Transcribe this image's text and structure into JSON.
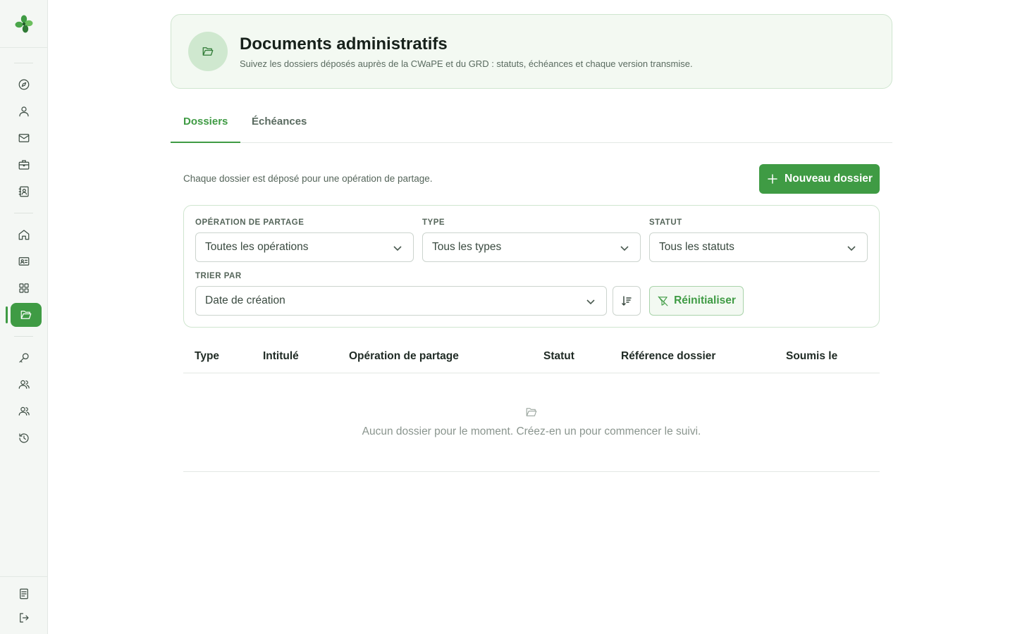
{
  "app": {
    "brand_color": "#3f9b44"
  },
  "sidebar": {
    "items": [
      {
        "icon": "compass-icon"
      },
      {
        "icon": "user-icon"
      },
      {
        "icon": "mail-icon"
      },
      {
        "icon": "briefcase-icon"
      },
      {
        "icon": "contact-book-icon"
      },
      {
        "icon": "home-icon"
      },
      {
        "icon": "id-card-icon"
      },
      {
        "icon": "grid-icon"
      },
      {
        "icon": "folder-open-icon",
        "active": true
      },
      {
        "icon": "search-key-icon"
      },
      {
        "icon": "users-icon"
      },
      {
        "icon": "users-alt-icon"
      },
      {
        "icon": "history-icon"
      },
      {
        "icon": "document-icon"
      },
      {
        "icon": "logout-icon"
      }
    ]
  },
  "header": {
    "title": "Documents administratifs",
    "subtitle": "Suivez les dossiers déposés auprès de la CWaPE et du GRD : statuts, échéances et chaque version transmise."
  },
  "tabs": [
    {
      "label": "Dossiers",
      "active": true
    },
    {
      "label": "Échéances",
      "active": false
    }
  ],
  "toolbar": {
    "description": "Chaque dossier est déposé pour une opération de partage.",
    "new_label": "Nouveau dossier"
  },
  "filters": {
    "operation": {
      "label": "OPÉRATION DE PARTAGE",
      "value": "Toutes les opérations"
    },
    "type": {
      "label": "TYPE",
      "value": "Tous les types"
    },
    "status": {
      "label": "STATUT",
      "value": "Tous les statuts"
    },
    "sort": {
      "label": "TRIER PAR",
      "value": "Date de création"
    },
    "reset_label": "Réinitialiser"
  },
  "table": {
    "columns": [
      "Type",
      "Intitulé",
      "Opération de partage",
      "Statut",
      "Référence dossier",
      "Soumis le"
    ],
    "empty_text": "Aucun dossier pour le moment. Créez-en un pour commencer le suivi."
  }
}
